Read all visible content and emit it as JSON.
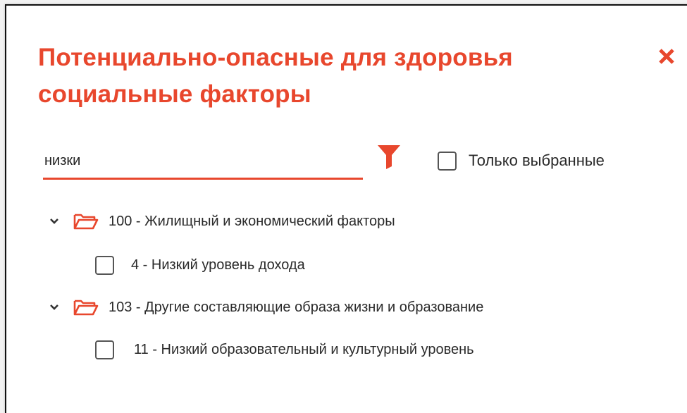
{
  "dialog": {
    "title": "Потенциально-опасные для здоровья социальные факторы",
    "close_icon": "close-icon"
  },
  "search": {
    "value": "низки",
    "placeholder": ""
  },
  "filter": {
    "icon": "filter-icon"
  },
  "only_selected": {
    "label": "Только выбранные",
    "checked": false
  },
  "tree": {
    "groups": [
      {
        "label": "100 - Жилищный и экономический факторы",
        "expanded": true,
        "icon": "folder-open-icon",
        "children": [
          {
            "label": "4 - Низкий уровень дохода",
            "checked": false
          }
        ]
      },
      {
        "label": "103 - Другие составляющие образа жизни и образование",
        "expanded": true,
        "icon": "folder-open-icon",
        "children": [
          {
            "label": "11 - Низкий образовательный и культурный уровень",
            "checked": false
          }
        ]
      }
    ]
  },
  "colors": {
    "accent": "#e8472d",
    "text": "#2a2a2a",
    "checkbox_border": "#555555"
  }
}
